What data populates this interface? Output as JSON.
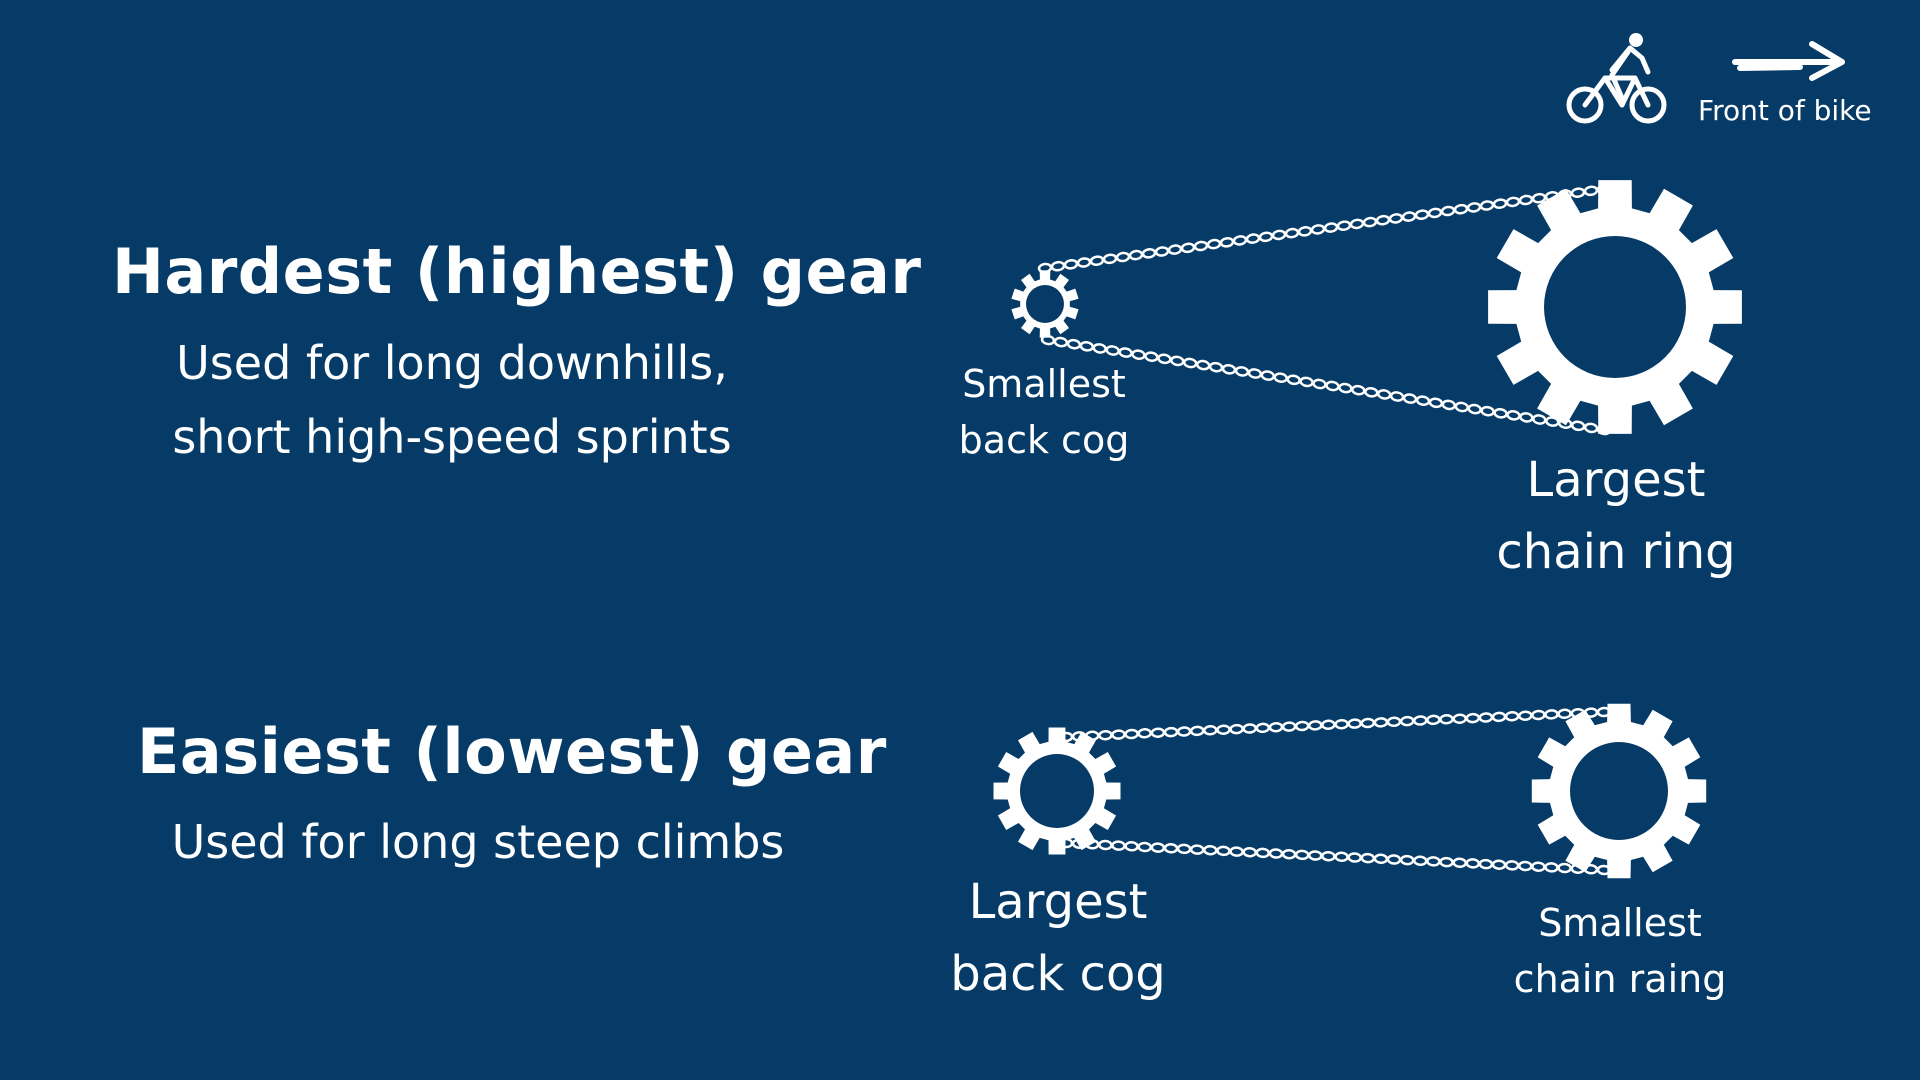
{
  "colors": {
    "background": "#063b67",
    "foreground": "#ffffff"
  },
  "legend": {
    "icon": "cyclist-icon",
    "arrow_icon": "right-arrow-icon",
    "text": "Front of bike"
  },
  "hardest": {
    "title": "Hardest (highest) gear",
    "desc_lines": [
      "Used for long downhills,",
      "short high-speed sprints"
    ],
    "back_label_lines": [
      "Smallest",
      "back cog"
    ],
    "front_label_lines": [
      "Largest",
      "chain ring"
    ]
  },
  "easiest": {
    "title": "Easiest (lowest) gear",
    "desc_lines": [
      "Used for long steep climbs"
    ],
    "back_label_lines": [
      "Largest",
      "back cog"
    ],
    "front_label_lines": [
      "Smallest",
      "chain raing"
    ]
  }
}
